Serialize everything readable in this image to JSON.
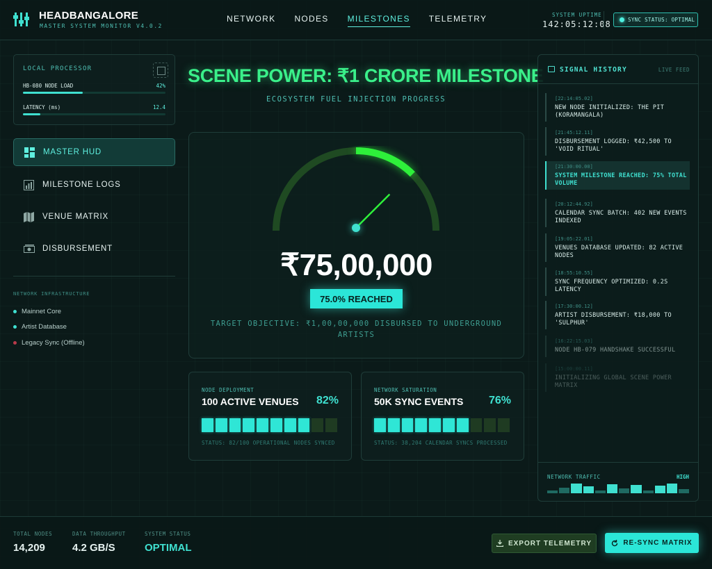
{
  "header": {
    "brand": "HEADBANGALORE",
    "subtitle": "MASTER SYSTEM MONITOR V4.0.2",
    "nav": [
      "NETWORK",
      "NODES",
      "MILESTONES",
      "TELEMETRY"
    ],
    "active_nav": "MILESTONES",
    "uptime_label": "SYSTEM UPTIME",
    "uptime_value": "142:05:12:08",
    "sync_status": "SYNC STATUS: OPTIMAL"
  },
  "local_processor": {
    "title": "LOCAL PROCESSOR",
    "metrics": [
      {
        "label": "HB-080 NODE LOAD",
        "value": "42%",
        "fill": 0.42
      },
      {
        "label": "LATENCY (ms)",
        "value": "12.4",
        "fill": 0.12
      }
    ]
  },
  "sidebar": {
    "items": [
      {
        "label": "MASTER HUD",
        "icon": "dashboard-icon",
        "active": true
      },
      {
        "label": "MILESTONE LOGS",
        "icon": "chart-icon",
        "active": false
      },
      {
        "label": "VENUE MATRIX",
        "icon": "map-icon",
        "active": false
      },
      {
        "label": "DISBURSEMENT",
        "icon": "money-icon",
        "active": false
      }
    ],
    "infra_title": "NETWORK INFRASTRUCTURE",
    "infra": [
      {
        "label": "Mainnet Core",
        "color": "#3fe0d0"
      },
      {
        "label": "Artist Database",
        "color": "#3fe0d0"
      },
      {
        "label": "Legacy Sync (Offline)",
        "color": "#b83a4a"
      }
    ]
  },
  "main": {
    "title": "SCENE POWER: ₹1 CRORE MILESTONE",
    "subtitle": "ECOSYSTEM FUEL INJECTION PROGRESS",
    "amount": "₹75,00,000",
    "progress": 0.75,
    "reached": "75.0% REACHED",
    "target": "TARGET OBJECTIVE: ₹1,00,00,000 DISBURSED TO UNDERGROUND ARTISTS"
  },
  "stats": [
    {
      "label": "NODE DEPLOYMENT",
      "headline": "100 ACTIVE VENUES",
      "pct": "82%",
      "segments_on": 8,
      "segments_total": 10,
      "status": "STATUS: 82/100 OPERATIONAL NODES SYNCED"
    },
    {
      "label": "NETWORK SATURATION",
      "headline": "50K SYNC EVENTS",
      "pct": "76%",
      "segments_on": 7,
      "segments_total": 10,
      "status": "STATUS: 38,204 CALENDAR SYNCS PROCESSED"
    }
  ],
  "signal": {
    "title": "SIGNAL HISTORY",
    "live": "LIVE FEED",
    "logs": [
      {
        "time": "[22:14:05.02]",
        "text": "NEW NODE INITIALIZED: THE PIT (KORAMANGALA)"
      },
      {
        "time": "[21:45:12.11]",
        "text": "DISBURSEMENT LOGGED: ₹42,500 TO 'VOID RITUAL'"
      },
      {
        "time": "[21:30:00.00]",
        "text": "SYSTEM MILESTONE REACHED: 75% TOTAL VOLUME",
        "highlight": true
      },
      {
        "time": "[20:12:44.92]",
        "text": "CALENDAR SYNC BATCH: 402 NEW EVENTS INDEXED"
      },
      {
        "time": "[19:05:22.01]",
        "text": "VENUES DATABASE UPDATED: 82 ACTIVE NODES"
      },
      {
        "time": "[18:55:10.55]",
        "text": "SYNC FREQUENCY OPTIMIZED: 0.2S LATENCY"
      },
      {
        "time": "[17:30:00.12]",
        "text": "ARTIST DISBURSEMENT: ₹18,000 TO 'SULPHUR'"
      },
      {
        "time": "[16:22:15.03]",
        "text": "NODE HB-079 HANDSHAKE SUCCESSFUL"
      },
      {
        "time": "[15:00:00.11]",
        "text": "INITIALIZING GLOBAL SCENE POWER MATRIX"
      }
    ],
    "traffic_label": "NETWORK TRAFFIC",
    "traffic_level": "HIGH",
    "traffic_bars": [
      0.3,
      0.55,
      1.0,
      0.7,
      0.25,
      0.9,
      0.5,
      0.85,
      0.3,
      0.75,
      1.0,
      0.45
    ]
  },
  "footer": {
    "stats": [
      {
        "label": "TOTAL NODES",
        "value": "14,209"
      },
      {
        "label": "DATA THROUGHPUT",
        "value": "4.2 GB/S"
      },
      {
        "label": "SYSTEM STATUS",
        "value": "OPTIMAL",
        "accent": true
      }
    ],
    "export_label": "EXPORT TELEMETRY",
    "resync_label": "RE-SYNC MATRIX"
  }
}
